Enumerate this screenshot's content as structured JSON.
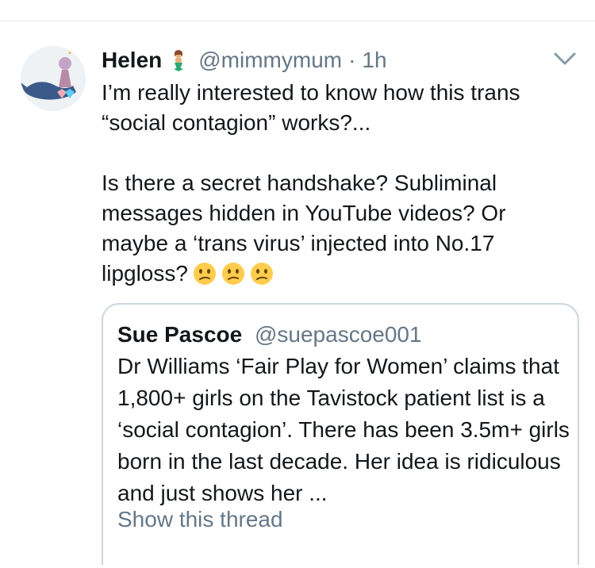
{
  "tweet": {
    "author_name": "Helen",
    "author_handle": "@mimmymum",
    "separator": "·",
    "time": "1h",
    "text_line_1": "I’m really interested to know how this trans “social contagion” works?...",
    "text_line_2": "Is there a secret handshake? Subliminal messages hidden in YouTube videos? Or maybe a ‘trans virus’ injected into No.17 lipgloss?",
    "emojis": [
      "confused-face",
      "confused-face",
      "confused-face"
    ]
  },
  "quoted_tweet": {
    "author_name": "Sue Pascoe",
    "author_handle": "@suepascoe001",
    "text": "Dr Williams ‘Fair Play for Women’ claims that 1,800+ girls on the Tavistock patient list is a ‘social contagion’. There has been 3.5m+ girls born in the last decade. Her idea is ridiculous and just shows her ...",
    "show_thread_label": "Show this thread"
  },
  "icons": {
    "avatar": "avatar-whale-illustration",
    "name_emoji": "mermaid-icon",
    "menu": "chevron-down-icon"
  },
  "colors": {
    "text_primary": "#14171a",
    "text_secondary": "#657786",
    "border": "#ccd6dd",
    "emoji_yellow": "#ffcc4d"
  }
}
